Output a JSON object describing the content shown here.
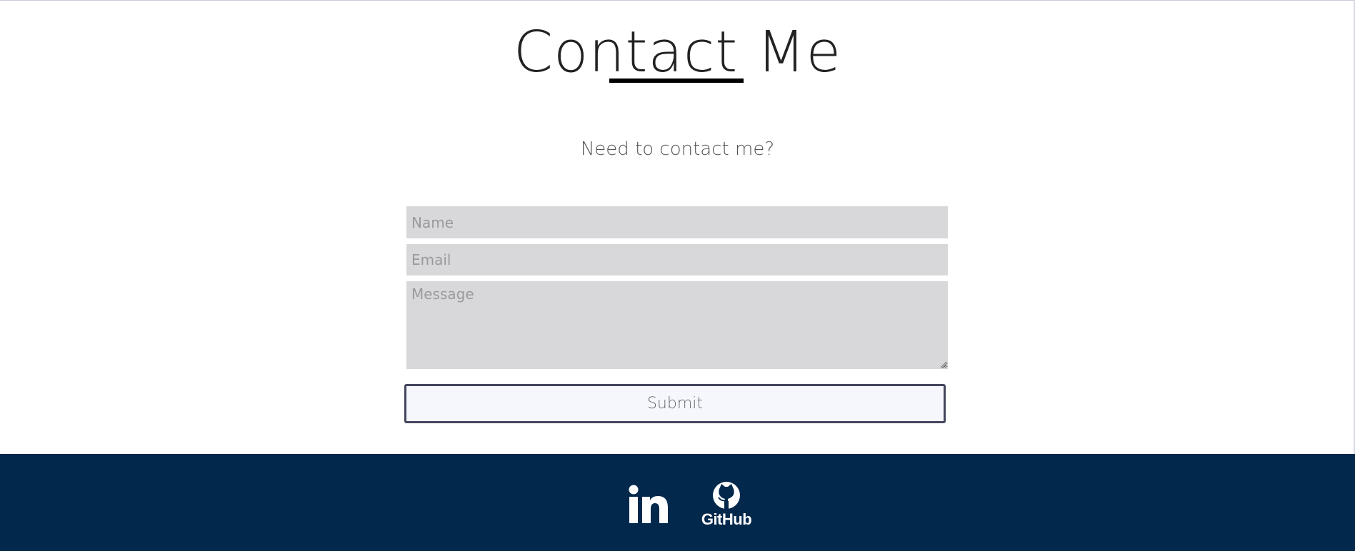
{
  "header": {
    "title": "Contact Me",
    "subtitle": "Need to contact me?"
  },
  "form": {
    "name_placeholder": "Name",
    "email_placeholder": "Email",
    "message_placeholder": "Message",
    "submit_label": "Submit"
  },
  "footer": {
    "background_color": "#02284c",
    "links": [
      {
        "icon": "linkedin-icon"
      },
      {
        "icon": "github-icon",
        "label": "GitHub"
      }
    ]
  }
}
